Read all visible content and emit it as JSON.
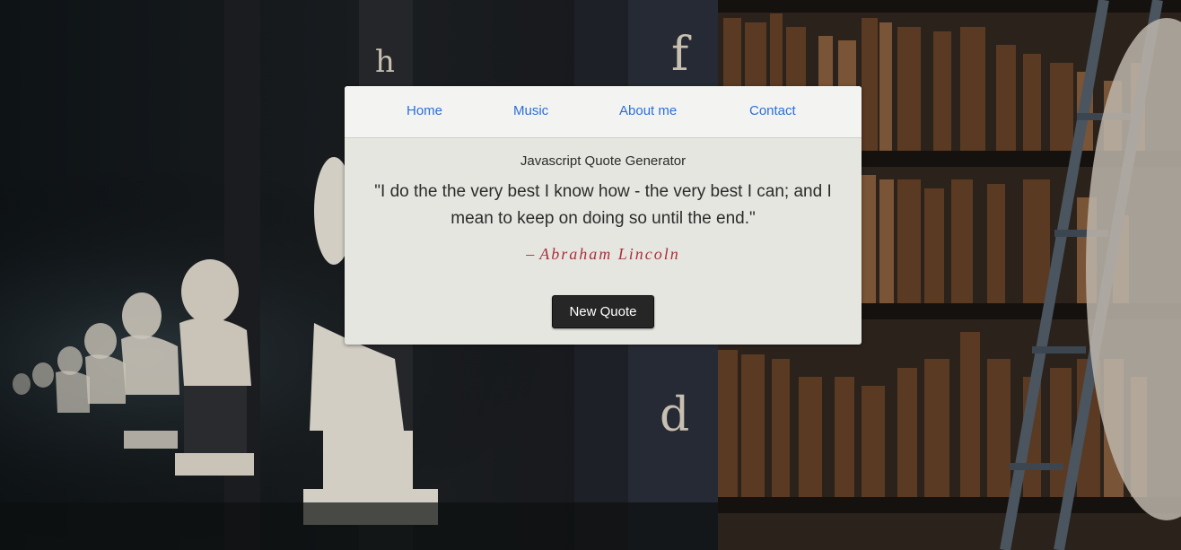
{
  "nav": {
    "items": [
      {
        "label": "Home"
      },
      {
        "label": "Music"
      },
      {
        "label": "About me"
      },
      {
        "label": "Contact"
      }
    ]
  },
  "main": {
    "heading": "Javascript Quote Generator",
    "quote_text": "\"I do the the very best I know how - the very best I can; and I mean to keep on doing so until the end.\"",
    "author_dash": "–",
    "author_name": "Abraham Lincoln",
    "new_quote_button": "New Quote"
  },
  "colors": {
    "link": "#2e6fd6",
    "author": "#a8323a",
    "button_bg": "#262626",
    "card_bg": "#e6e6e1",
    "nav_bg": "#f3f3f1"
  }
}
